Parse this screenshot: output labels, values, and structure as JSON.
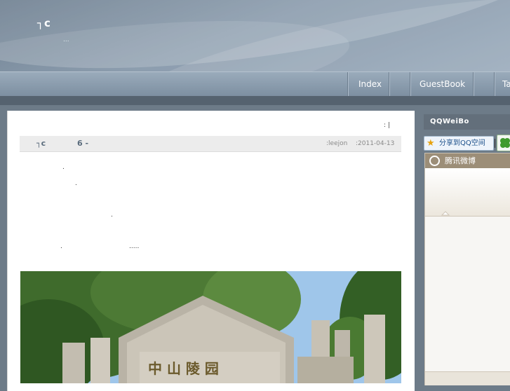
{
  "site": {
    "title": "┐c",
    "subtitle": "..."
  },
  "nav": {
    "items": [
      "Index",
      "GuestBook",
      "Ta"
    ]
  },
  "post": {
    "meta_top": ":   |",
    "title": "┐c",
    "number": "6  -",
    "author": ":leejon",
    "date": ":2011-04-13",
    "body_marks": [
      ".",
      ".",
      ".",
      ".",
      "....."
    ]
  },
  "sidebar": {
    "widget_title": "QQWeiBo",
    "share_label": "分享到QQ空间",
    "weibo_title": "腾讯微博"
  },
  "photo": {
    "sign_text": "中 山 陵 园"
  },
  "icons": {
    "share": "star-icon",
    "clover": "clover-icon",
    "weibo_logo": "weibo-logo-icon"
  },
  "colors": {
    "header": "#7f92a5",
    "nav": "#8c9daf",
    "sidebar_head": "#636f7b",
    "weibo_head": "#9c8e78"
  }
}
